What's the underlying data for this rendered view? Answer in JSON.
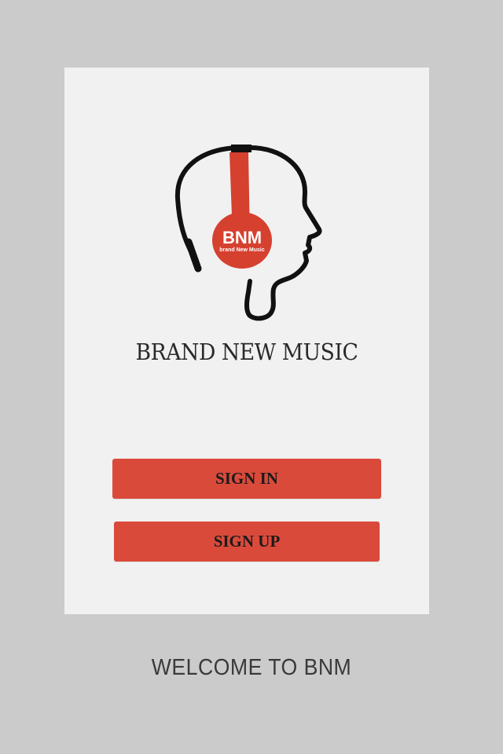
{
  "colors": {
    "background": "#cbcbcb",
    "card": "#f1f1f1",
    "accent": "#da4a3b",
    "text_dark": "#1b1b1b"
  },
  "logo": {
    "icon": "headphones-head-icon",
    "badge_text": "BNM",
    "badge_subtext": "brand New Music"
  },
  "brand_title": "BRAND NEW MUSIC",
  "buttons": {
    "sign_in": "SIGN IN",
    "sign_up": "SIGN UP"
  },
  "footer": {
    "welcome": "WELCOME TO BNM"
  }
}
